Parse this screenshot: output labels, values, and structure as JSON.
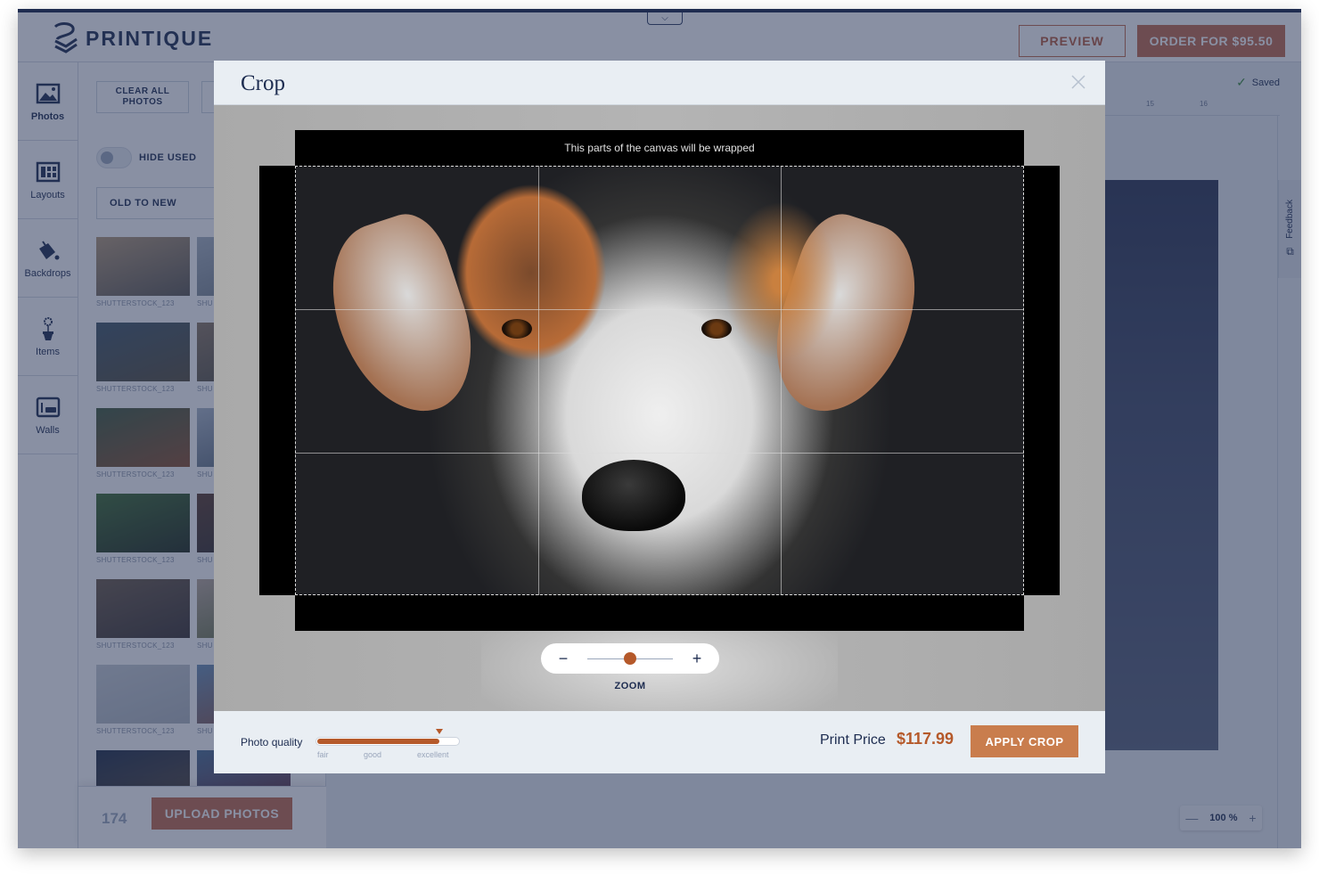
{
  "header": {
    "brand": "PRINTIQUE",
    "preview_label": "PREVIEW",
    "order_label": "ORDER FOR $95.50",
    "collapse_icon": "chevron-down-icon"
  },
  "leftnav": {
    "items": [
      {
        "label": "Photos",
        "icon": "image-icon",
        "active": true
      },
      {
        "label": "Layouts",
        "icon": "grid-icon",
        "active": false
      },
      {
        "label": "Backdrops",
        "icon": "paint-bucket-icon",
        "active": false
      },
      {
        "label": "Items",
        "icon": "flower-pot-icon",
        "active": false
      },
      {
        "label": "Walls",
        "icon": "wall-icon",
        "active": false
      }
    ]
  },
  "panel": {
    "clear_label": "CLEAR ALL PHOTOS",
    "hide_used_label": "HIDE USED",
    "hide_used_on": false,
    "sort_value": "OLD TO NEW",
    "photos": [
      {
        "caption": "SHUTTERSTOCK_123",
        "colors": [
          "#b49a78",
          "#5a5650"
        ]
      },
      {
        "caption": "SHU",
        "colors": [
          "#a8b3bf",
          "#6f7a83"
        ]
      },
      {
        "caption": "SHUTTERSTOCK_123",
        "colors": [
          "#3f5566",
          "#544d3a"
        ]
      },
      {
        "caption": "SHU",
        "colors": [
          "#8a7660",
          "#4a4a3f"
        ]
      },
      {
        "caption": "SHUTTERSTOCK_123",
        "colors": [
          "#3f5a3c",
          "#8a4e2c"
        ]
      },
      {
        "caption": "SHU",
        "colors": [
          "#aab6c6",
          "#506070"
        ]
      },
      {
        "caption": "SHUTTERSTOCK_123",
        "colors": [
          "#3d6b2f",
          "#1f2a1a"
        ]
      },
      {
        "caption": "SHU",
        "colors": [
          "#5a3a2a",
          "#2a2a2a"
        ]
      },
      {
        "caption": "SHUTTERSTOCK_123",
        "colors": [
          "#6b5a47",
          "#3a3230"
        ]
      },
      {
        "caption": "SHU",
        "colors": [
          "#b8a89a",
          "#5d6b3d"
        ]
      },
      {
        "caption": "SHUTTERSTOCK_123",
        "colors": [
          "#c7cdd3",
          "#aeb5bd"
        ]
      },
      {
        "caption": "SHU",
        "colors": [
          "#6a8fb5",
          "#8a5040"
        ]
      },
      {
        "caption": "",
        "colors": [
          "#1e2c45",
          "#5a4a3a"
        ]
      },
      {
        "caption": "",
        "colors": [
          "#4a6d92",
          "#6a3040"
        ]
      }
    ],
    "photo_count": "174",
    "upload_label": "UPLOAD PHOTOS"
  },
  "canvas": {
    "saved_label": "Saved",
    "ruler_ticks": [
      "15",
      "16"
    ],
    "feedback_label": "Feedback",
    "zoom_value": "100 %"
  },
  "modal": {
    "title": "Crop",
    "wrap_notice": "This parts of the canvas  will be wrapped",
    "zoom_label": "ZOOM",
    "zoom_minus": "−",
    "zoom_plus": "+",
    "zoom_level": 0.5,
    "photo_quality_label": "Photo quality",
    "photo_quality": 0.87,
    "quality_ticks": [
      "fair",
      "good",
      "excellent"
    ],
    "print_price_label": "Print Price",
    "print_price": "$117.99",
    "apply_label": "APPLY CROP"
  },
  "colors": {
    "brand_navy": "#142347",
    "accent": "#c0694a",
    "apply": "#c97d4d",
    "price": "#b5592a"
  }
}
